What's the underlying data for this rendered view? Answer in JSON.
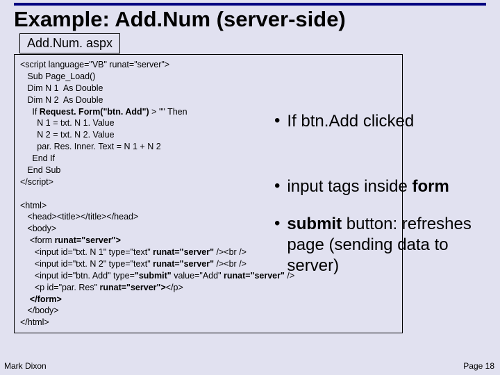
{
  "title": "Example: Add.Num (server-side)",
  "filename": "Add.Num. aspx",
  "code": {
    "l1": "<script language=\"VB\" runat=\"server\">",
    "l2": "   Sub Page_Load()",
    "l3": "   Dim N 1  As Double",
    "l4": "   Dim N 2  As Double",
    "l5a": "     If ",
    "l5b": "Request. Form(\"btn. Add\")",
    "l5c": " > \"\" Then",
    "l6": "       N 1 = txt. N 1. Value",
    "l7": "       N 2 = txt. N 2. Value",
    "l8": "       par. Res. Inner. Text = N 1 + N 2",
    "l9": "     End If",
    "l10": "   End Sub",
    "l11": "</scr",
    "l11b": "ipt>",
    "bl": "",
    "h1": "<html>",
    "h2": "   <head><title></title></head>",
    "h3": "   <body>",
    "h4a": "    <form ",
    "h4b": "runat=\"server\">",
    "h5a": "      <input id=\"txt. N 1\" type=\"text\" ",
    "h5b": "runat=\"server\" ",
    "h5c": "/><br />",
    "h6a": "      <input id=\"txt. N 2\" type=\"text\" ",
    "h6b": "runat=\"server\" ",
    "h6c": "/><br />",
    "h7a": "      <input id=\"btn. Add\" type=",
    "h7b": "\"submit\"",
    "h7c": " value=\"Add\" ",
    "h7d": "runat=\"server\" ",
    "h7e": "/>",
    "h8a": "      <p id=\"par. Res\" ",
    "h8b": "runat=\"server\">",
    "h8c": "</p>",
    "h9": "    </form>",
    "h10": "   </body>",
    "h11": "</html>"
  },
  "bullets": {
    "b1": "If btn.Add clicked",
    "b2a": "input tags inside ",
    "b2b": "form",
    "b3a": "submit",
    "b3b": " button: refreshes page (sending data to server)"
  },
  "footer": {
    "left": "Mark Dixon",
    "right": "Page 18"
  }
}
